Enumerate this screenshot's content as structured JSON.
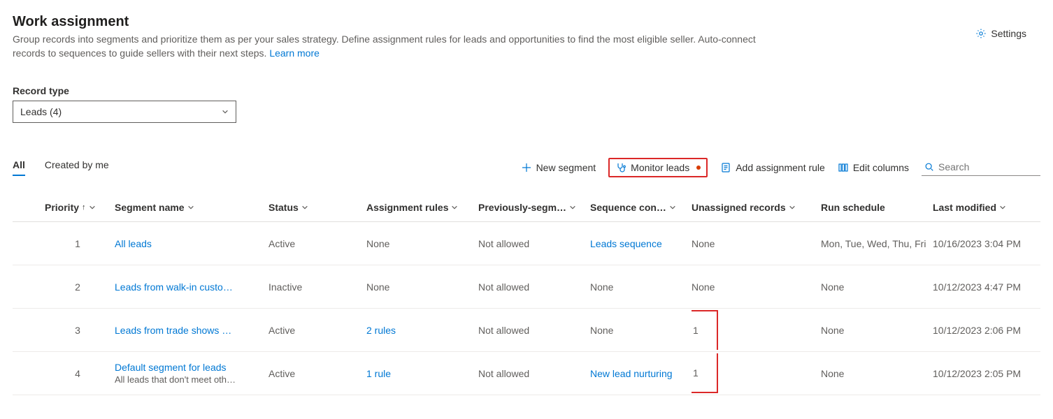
{
  "header": {
    "title": "Work assignment",
    "subtitle_part1": "Group records into segments and prioritize them as per your sales strategy. Define assignment rules for leads and opportunities to find the most eligible seller. Auto-connect records to sequences to guide sellers with their next steps. ",
    "learn_more": "Learn more",
    "settings_label": "Settings"
  },
  "record_type": {
    "label": "Record type",
    "value": "Leads (4)"
  },
  "tabs": {
    "all": "All",
    "created_by_me": "Created by me"
  },
  "actions": {
    "new_segment": "New segment",
    "monitor_leads": "Monitor leads",
    "add_assignment_rule": "Add assignment rule",
    "edit_columns": "Edit columns",
    "search_placeholder": "Search"
  },
  "columns": {
    "priority": "Priority",
    "segment_name": "Segment name",
    "status": "Status",
    "assignment_rules": "Assignment rules",
    "previously_segm": "Previously-segm…",
    "sequence_con": "Sequence con…",
    "unassigned_records": "Unassigned records",
    "run_schedule": "Run schedule",
    "last_modified": "Last modified"
  },
  "rows": [
    {
      "priority": "1",
      "segment_name": "All leads",
      "segment_sub": "",
      "status": "Active",
      "assignment_rules": "None",
      "assignment_link": false,
      "previously": "Not allowed",
      "sequence": "Leads sequence",
      "sequence_link": true,
      "unassigned": "None",
      "unassigned_boxed": false,
      "run_schedule": "Mon, Tue, Wed, Thu, Fri",
      "last_modified": "10/16/2023 3:04 PM"
    },
    {
      "priority": "2",
      "segment_name": "Leads from walk-in custo…",
      "segment_sub": "",
      "status": "Inactive",
      "assignment_rules": "None",
      "assignment_link": false,
      "previously": "Not allowed",
      "sequence": "None",
      "sequence_link": false,
      "unassigned": "None",
      "unassigned_boxed": false,
      "run_schedule": "None",
      "last_modified": "10/12/2023 4:47 PM"
    },
    {
      "priority": "3",
      "segment_name": "Leads from trade shows …",
      "segment_sub": "",
      "status": "Active",
      "assignment_rules": "2 rules",
      "assignment_link": true,
      "previously": "Not allowed",
      "sequence": "None",
      "sequence_link": false,
      "unassigned": "1",
      "unassigned_boxed": true,
      "unassigned_box_pos": "top",
      "run_schedule": "None",
      "last_modified": "10/12/2023 2:06 PM"
    },
    {
      "priority": "4",
      "segment_name": "Default segment for leads",
      "segment_sub": "All leads that don't meet oth…",
      "status": "Active",
      "assignment_rules": "1 rule",
      "assignment_link": true,
      "previously": "Not allowed",
      "sequence": "New lead nurturing",
      "sequence_link": true,
      "unassigned": "1",
      "unassigned_boxed": true,
      "unassigned_box_pos": "bottom",
      "run_schedule": "None",
      "last_modified": "10/12/2023 2:05 PM"
    }
  ]
}
